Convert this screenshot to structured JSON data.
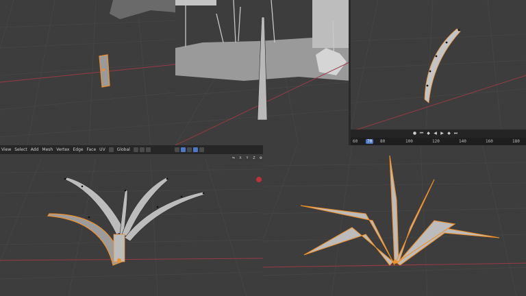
{
  "viewport_header": {
    "menus": [
      "View",
      "Select",
      "Add",
      "Mesh",
      "Vertex",
      "Edge",
      "Face",
      "UV"
    ],
    "orientation": "Global"
  },
  "gizmo_labels": [
    "X",
    "Y",
    "Z"
  ],
  "timeline": {
    "ticks": [
      "60",
      "70",
      "80",
      "100",
      "120",
      "140",
      "160",
      "180"
    ],
    "current_frame": "70"
  },
  "colors": {
    "background": "#3d3d3d",
    "grid": "#474747",
    "x_axis": "#9a3a45",
    "selection": "#f0902a",
    "mesh": "#b9b9b9"
  }
}
